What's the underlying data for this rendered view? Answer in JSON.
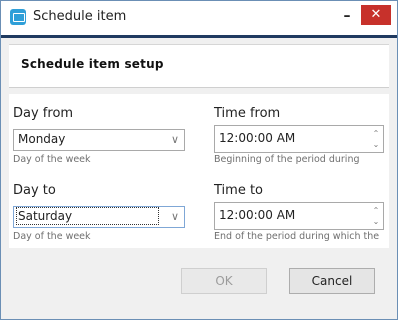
{
  "window": {
    "title": "Schedule item",
    "minimize_glyph": "–",
    "close_glyph": "✕"
  },
  "header": {
    "title": "Schedule item setup"
  },
  "form": {
    "day_from": {
      "label": "Day from",
      "value": "Monday",
      "help": "Day of the week"
    },
    "time_from": {
      "label": "Time from",
      "value": "12:00:00 AM",
      "help": "Beginning of the period during"
    },
    "day_to": {
      "label": "Day to",
      "value": "Saturday",
      "help": "Day of the week"
    },
    "time_to": {
      "label": "Time to",
      "value": "12:00:00 AM",
      "help": "End of the period during which the"
    }
  },
  "footer": {
    "ok_label": "OK",
    "cancel_label": "Cancel"
  },
  "icons": {
    "dropdown": "chevron-down-icon",
    "spin_up": "spin-up-icon",
    "spin_down": "spin-down-icon"
  },
  "colors": {
    "title_bar_accent": "#1f3a60",
    "close_button": "#c7312b",
    "app_icon": "#2f9fd8"
  }
}
